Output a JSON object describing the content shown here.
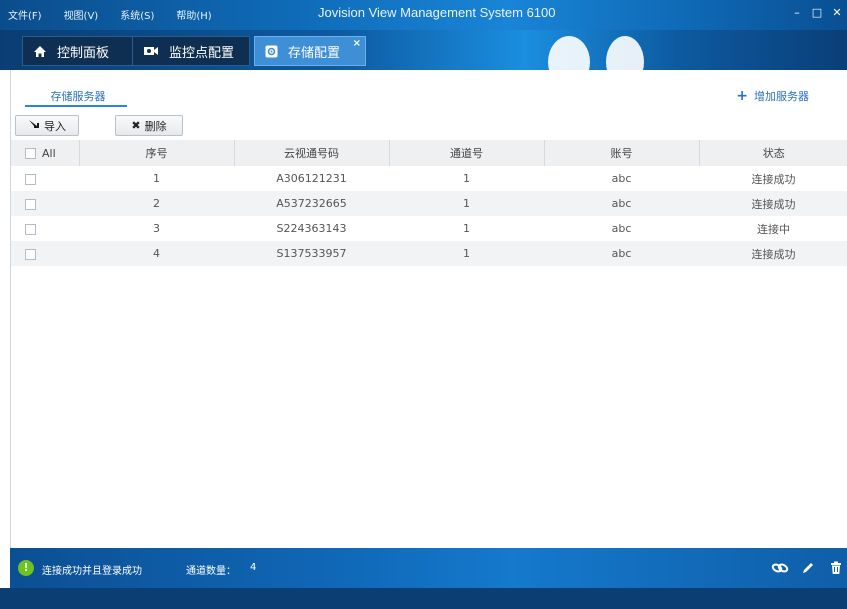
{
  "menu": {
    "items": [
      "文件(F)",
      "视图(V)",
      "系统(S)",
      "帮助(H)"
    ]
  },
  "app_title": "Jovision View Management System 6100",
  "window_controls": {
    "minimize": "–",
    "maximize": "□",
    "close": "✕"
  },
  "tabs": [
    {
      "label": "控制面板",
      "icon": "home-icon"
    },
    {
      "label": "监控点配置",
      "icon": "camera-icon"
    },
    {
      "label": "存储配置",
      "icon": "gear-icon",
      "closable": true,
      "close_glyph": "×"
    }
  ],
  "subtab": {
    "label": "存储服务器"
  },
  "add_server": {
    "label": "增加服务器"
  },
  "toolbar": {
    "import_label": "导入",
    "delete_label": "删除"
  },
  "table": {
    "headers": [
      "All",
      "序号",
      "云视通号码",
      "通道号",
      "账号",
      "状态"
    ],
    "rows": [
      {
        "index": "1",
        "cloud_id": "A306121231",
        "channel": "1",
        "account": "abc",
        "status": "连接成功"
      },
      {
        "index": "2",
        "cloud_id": "A537232665",
        "channel": "1",
        "account": "abc",
        "status": "连接成功"
      },
      {
        "index": "3",
        "cloud_id": "S224363143",
        "channel": "1",
        "account": "abc",
        "status": "连接中"
      },
      {
        "index": "4",
        "cloud_id": "S137533957",
        "channel": "1",
        "account": "abc",
        "status": "连接成功"
      }
    ]
  },
  "statusbar": {
    "icon_glyph": "!",
    "message": "连接成功并且登录成功",
    "channel_label": "通道数量：",
    "channel_count": "4"
  },
  "colors": {
    "accent": "#2a72b8",
    "titlebar": "#0f6bb8",
    "statusbar": "#1068b8",
    "success": "#6dc321"
  }
}
